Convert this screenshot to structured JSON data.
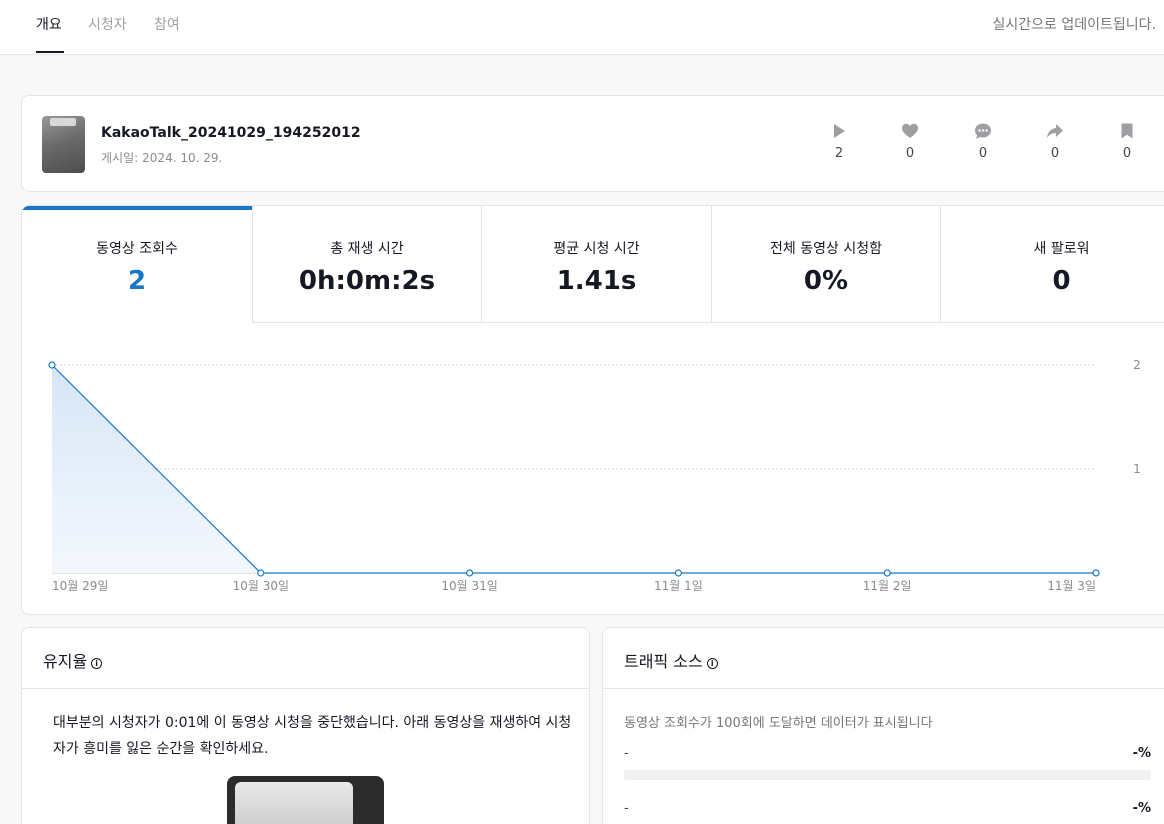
{
  "tabs": [
    {
      "label": "개요",
      "active": true
    },
    {
      "label": "시청자",
      "active": false
    },
    {
      "label": "참여",
      "active": false
    }
  ],
  "realtime_note": "실시간으로 업데이트됩니다.",
  "video": {
    "title": "KakaoTalk_20241029_194252012",
    "posted_label": "게시일:",
    "posted_date": "2024. 10. 29.",
    "stats": [
      {
        "icon": "play-icon",
        "count": "2"
      },
      {
        "icon": "heart-icon",
        "count": "0"
      },
      {
        "icon": "comment-icon",
        "count": "0"
      },
      {
        "icon": "share-icon",
        "count": "0"
      },
      {
        "icon": "bookmark-icon",
        "count": "0"
      }
    ]
  },
  "metrics": [
    {
      "label": "동영상 조회수",
      "value": "2",
      "active": true
    },
    {
      "label": "총 재생 시간",
      "value": "0h:0m:2s",
      "active": false
    },
    {
      "label": "평균 시청 시간",
      "value": "1.41s",
      "active": false
    },
    {
      "label": "전체 동영상 시청함",
      "value": "0%",
      "active": false
    },
    {
      "label": "새 팔로워",
      "value": "0",
      "active": false
    }
  ],
  "colors": {
    "accent": "#1677c9",
    "area_top": "#d6e6f6"
  },
  "chart_data": {
    "type": "area",
    "categories": [
      "10월 29일",
      "10월 30일",
      "10월 31일",
      "11월 1일",
      "11월 2일",
      "11월 3일"
    ],
    "values": [
      2,
      0,
      0,
      0,
      0,
      0
    ],
    "ylim": [
      0,
      2
    ],
    "yticks": [
      "1",
      "2"
    ],
    "grid": true,
    "y_axis_side": "right"
  },
  "retention": {
    "title": "유지율",
    "text": "대부분의 시청자가 0:01에 이 동영상 시청을 중단했습니다. 아래 동영상을 재생하여 시청자가 흥미를 잃은 순간을 확인하세요."
  },
  "traffic": {
    "title": "트래픽 소스",
    "note": "동영상 조회수가 100회에 도달하면 데이터가 표시됩니다",
    "rows": [
      {
        "name": "-",
        "pct": "-%"
      },
      {
        "name": "-",
        "pct": "-%"
      }
    ]
  }
}
